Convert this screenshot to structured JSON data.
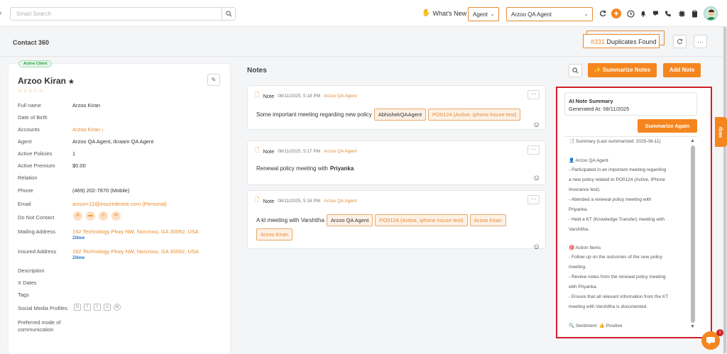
{
  "topbar": {
    "search_placeholder": "Smart Search",
    "whats_new": "What's New",
    "role_select": "Agent",
    "agent_select": "Arzoo QA Agent"
  },
  "header": {
    "title": "Contact 360",
    "duplicates_count": "#331",
    "duplicates_label": "Duplicates Found"
  },
  "contact": {
    "status_badge": "Active Client",
    "name": "Arzoo Kiran",
    "stars": "☆☆☆☆☆",
    "fields": [
      {
        "label": "Full name",
        "value": "Arzoo Kiran"
      },
      {
        "label": "Date of Birth",
        "value": ""
      },
      {
        "label": "Accounts",
        "value": "Arzoo Kiran ›"
      },
      {
        "label": "Agent",
        "value": "Arzoo QA Agent, Ikraam QA Agent"
      },
      {
        "label": "Active Policies",
        "value": "1"
      },
      {
        "label": "Active Premium",
        "value": "$0.00"
      },
      {
        "label": "Relation",
        "value": ""
      },
      {
        "label": "Phone",
        "value": "(469) 202-7870 (Mobile)"
      },
      {
        "label": "Email",
        "value": "arzoo+12@insuredmine.com  (Personal)"
      },
      {
        "label": "Do Not Contact",
        "value": ""
      },
      {
        "label": "Mailing Address",
        "value": "192 Technology Pkwy NW, Norcross, GA 30092, USA"
      },
      {
        "label": "Insured Address",
        "value": "192 Technology Pkwy NW, Norcross, GA 30092, USA"
      },
      {
        "label": "Description",
        "value": ""
      },
      {
        "label": "X Dates",
        "value": ""
      },
      {
        "label": "Tags",
        "value": ""
      },
      {
        "label": "Social Media Profiles",
        "value": ""
      },
      {
        "label": "Preferred mode of",
        "value": ""
      }
    ],
    "preferred_mode_line2": "communication",
    "zillow": "Zillow"
  },
  "notes": {
    "title": "Notes",
    "summarize_label": "Summarize Notes",
    "add_label": "Add Note",
    "items": [
      {
        "type": "Note",
        "date": "08/11/2025, 5:18 PM",
        "agent": "Arzoo QA Agent",
        "text": "Some important meeting regarding new policy",
        "tags": [
          "AbhishekQAAgent",
          "PO0124 (Active, iphone insure test)"
        ]
      },
      {
        "type": "Note",
        "date": "08/11/2025, 5:17 PM",
        "agent": "Arzoo QA Agent",
        "text": "Renewal policy meeting with",
        "bold": "Priyanka"
      },
      {
        "type": "Note",
        "date": "08/11/2025, 5:16 PM",
        "agent": "Arzoo QA Agent",
        "text": "A kt meeting with Varshitha",
        "tags": [
          "Arzoo QA Agent",
          "PO0124 (Active, iphone insure test)",
          "Arzoo Kiran",
          "Arzoo Kiran"
        ]
      }
    ]
  },
  "ai_summary": {
    "title": "AI Note Summary",
    "generated": "Generated At: 08/11/2025",
    "again_label": "Summarize Again",
    "lines": [
      "📑 Summary (Last summarized: 2025-08-11)",
      "👤 Arzoo QA Agent",
      "- Participated in an important meeting regarding",
      "a new policy related to PO0124 (Active, iPhone",
      "Insurance test).",
      "- Attended a renewal policy meeting with",
      "Priyanka.",
      "- Held a KT (Knowledge Transfer) meeting with",
      "Varshitha.",
      "🎯 Action Items",
      "- Follow up on the outcomes of the new policy",
      "meeting.",
      "- Review notes from the renewal policy meeting",
      "with Priyanka.",
      "- Ensure that all relevant information from the KT",
      "meeting with Varshitha is documented.",
      "🔍 Sentiment: 👍 Positive"
    ]
  },
  "help_label": "Help",
  "chat_badge": "1"
}
